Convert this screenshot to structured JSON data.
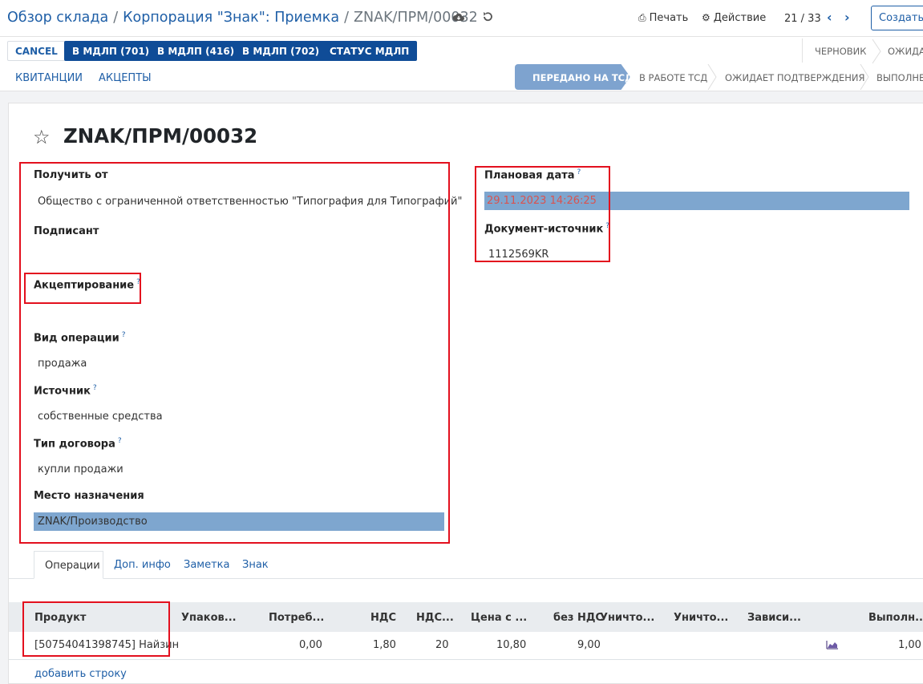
{
  "breadcrumb": {
    "items": [
      "Обзор склада",
      "Корпорация \"Знак\": Приемка"
    ],
    "current": "ZNAK/ПРМ/00032"
  },
  "toolbar": {
    "print": "Печать",
    "action": "Действие",
    "pager": "21 / 33",
    "create": "Создать е"
  },
  "buttons": {
    "cancel": "CANCEL",
    "mdlp701": "В МДЛП (701)",
    "mdlp416": "В МДЛП (416)",
    "mdlp702": "В МДЛП (702)",
    "status_mdlp": "СТАТУС МДЛП",
    "receipts": "КВИТАНЦИИ",
    "accepts": "АКЦЕПТЫ"
  },
  "status_top": [
    "ЧЕРНОВИК",
    "ОЖИДА"
  ],
  "stages": {
    "active": "ПЕРЕДАНО НА ТСД",
    "s2": "В РАБОТЕ ТСД",
    "s3": "ОЖИДАЕТ ПОДТВЕРЖДЕНИЯ",
    "s4": "ВЫПОЛНЕ"
  },
  "record": {
    "title": "ZNAK/ПРМ/00032",
    "fields": {
      "receive_from_label": "Получить от",
      "receive_from_value": "Общество с ограниченной ответственностью \"Типография для Типографий\"",
      "signer_label": "Подписант",
      "acceptance_label": "Акцептирование",
      "operation_type_label": "Вид операции",
      "operation_type_value": "продажа",
      "source_label": "Источник",
      "source_value": "собственные средства",
      "contract_type_label": "Тип договора",
      "contract_type_value": "купли продажи",
      "destination_label": "Место назначения",
      "destination_value": "ZNAK/Производство",
      "planned_date_label": "Плановая дата",
      "planned_date_value": "29.11.2023 14:26:25",
      "source_doc_label": "Документ-источник",
      "source_doc_value": "1112569KR",
      "help_mark": "?"
    }
  },
  "tabs": [
    "Операции",
    "Доп. инфо",
    "Заметка",
    "Знак"
  ],
  "table": {
    "headers": [
      "Продукт",
      "Упаков...",
      "Потреб...",
      "НДС",
      "НДС...",
      "Цена с ...",
      "без НДС",
      "Уничто...",
      "Уничто...",
      "Зависи...",
      "Выполн..."
    ],
    "rows": [
      {
        "product": "[50754041398745] Найзин",
        "consumed": "0,00",
        "vat": "1,80",
        "vat_pct": "20",
        "price_with_vat": "10,80",
        "no_vat": "9,00",
        "done": "1,00"
      }
    ],
    "add_line": "добавить строку"
  },
  "colors": {
    "primary": "#0f4c97",
    "link": "#1f5fa7",
    "highlight": "#7ea6cf",
    "annotation_red": "#e3101e",
    "date_red": "#d9534f"
  }
}
